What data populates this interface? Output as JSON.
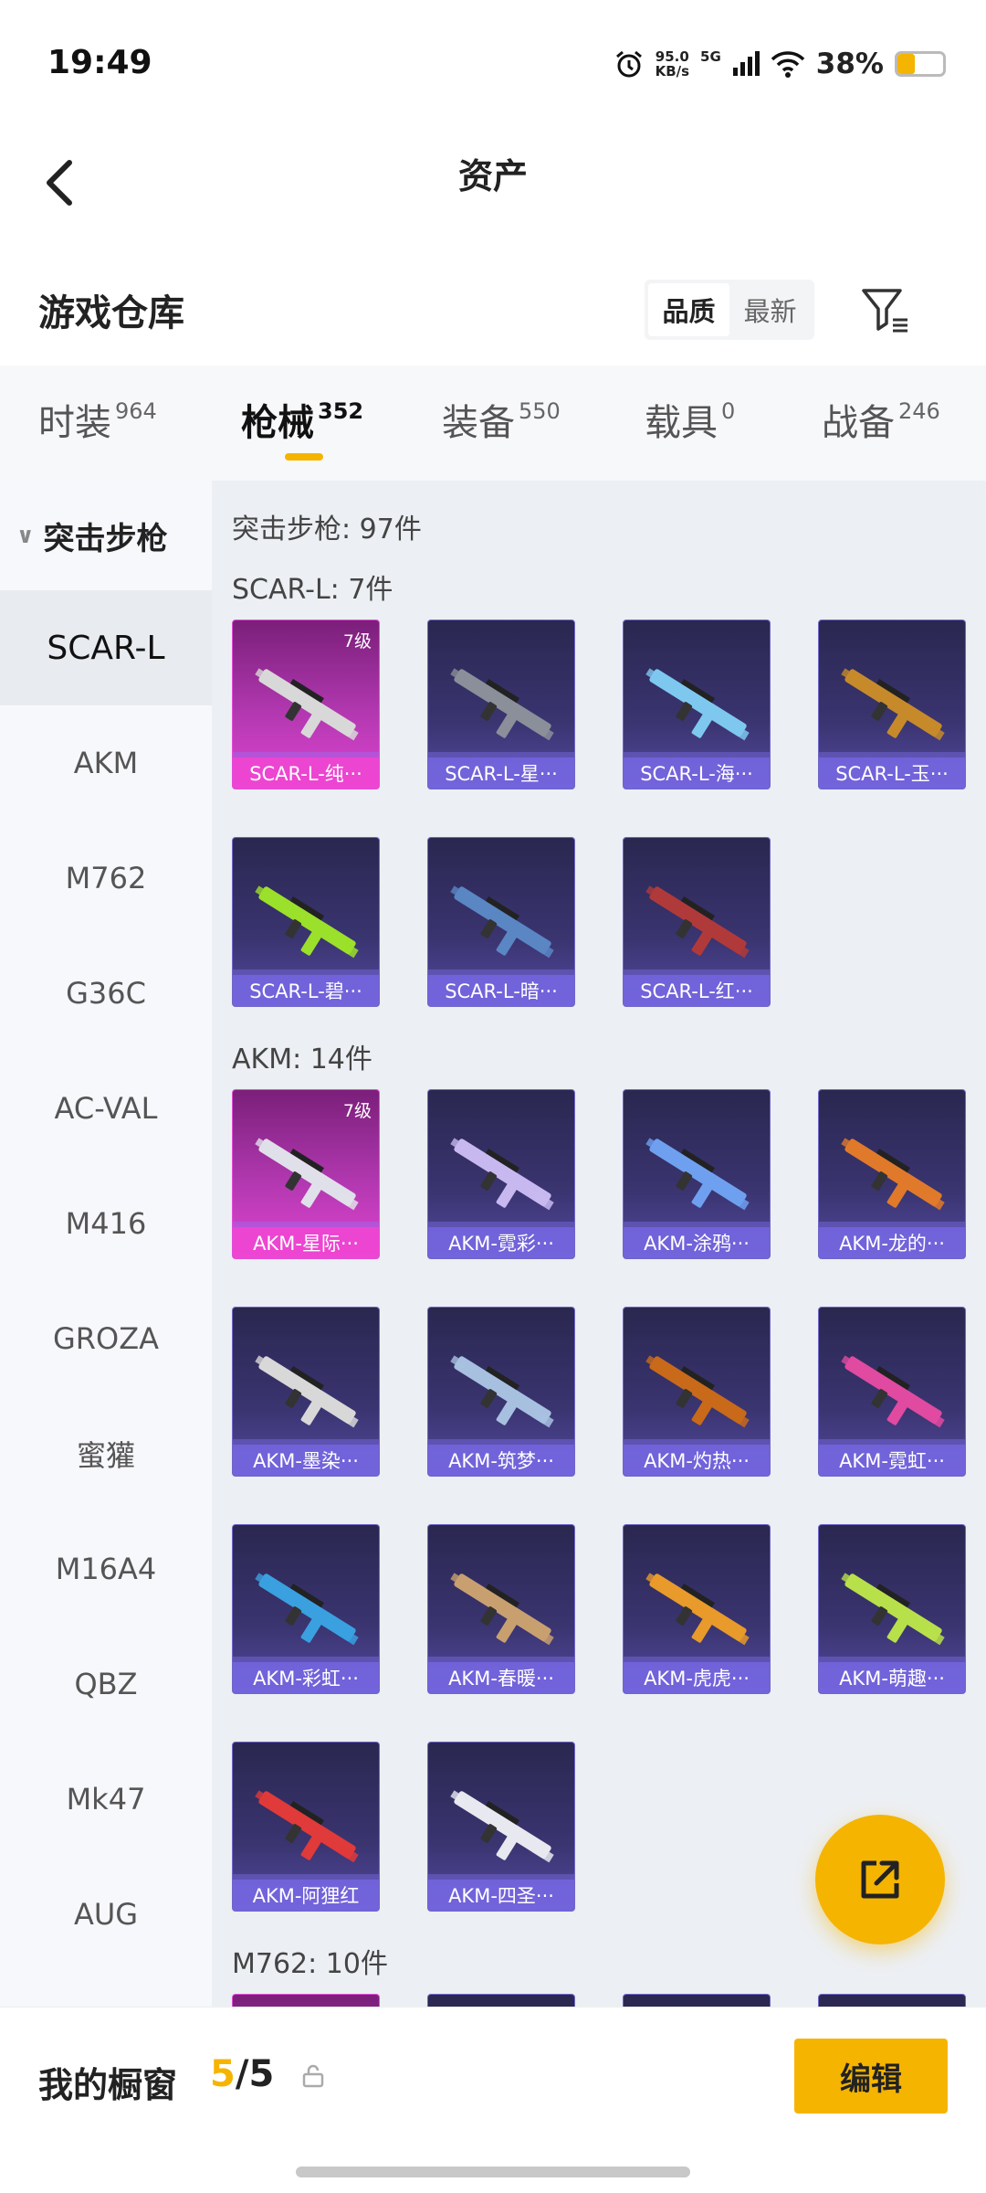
{
  "status": {
    "time": "19:49",
    "speed_top": "95.0",
    "speed_bottom": "KB/s",
    "network": "5G",
    "battery_text": "38%",
    "battery_level": 0.38
  },
  "header": {
    "title": "资产"
  },
  "warehouse": {
    "title": "游戏仓库",
    "sort_options": [
      {
        "label": "品质",
        "active": true
      },
      {
        "label": "最新",
        "active": false
      }
    ]
  },
  "tabs": [
    {
      "label": "时装",
      "count": "964",
      "active": false
    },
    {
      "label": "枪械",
      "count": "352",
      "active": true
    },
    {
      "label": "装备",
      "count": "550",
      "active": false
    },
    {
      "label": "载具",
      "count": "0",
      "active": false
    },
    {
      "label": "战备",
      "count": "246",
      "active": false
    }
  ],
  "sidebar": {
    "category": "突击步枪",
    "items": [
      "SCAR-L",
      "AKM",
      "M762",
      "G36C",
      "AC-VAL",
      "M416",
      "GROZA",
      "蜜獾",
      "M16A4",
      "QBZ",
      "Mk47",
      "AUG"
    ],
    "active_index": 0
  },
  "content": {
    "total": "突击步枪: 97件",
    "sections": [
      {
        "title": "SCAR-L: 7件",
        "items": [
          {
            "name": "SCAR-L-纯···",
            "level": "7级",
            "rare": true,
            "color": "#d8d8d8"
          },
          {
            "name": "SCAR-L-星···",
            "level": "",
            "rare": false,
            "color": "#8a8f99"
          },
          {
            "name": "SCAR-L-海···",
            "level": "",
            "rare": false,
            "color": "#7ec8f0"
          },
          {
            "name": "SCAR-L-玉···",
            "level": "",
            "rare": false,
            "color": "#c78a2a"
          },
          {
            "name": "SCAR-L-碧···",
            "level": "",
            "rare": false,
            "color": "#9be02a"
          },
          {
            "name": "SCAR-L-暗···",
            "level": "",
            "rare": false,
            "color": "#5a86c4"
          },
          {
            "name": "SCAR-L-红···",
            "level": "",
            "rare": false,
            "color": "#b03a3a"
          }
        ]
      },
      {
        "title": "AKM: 14件",
        "items": [
          {
            "name": "AKM-星际···",
            "level": "7级",
            "rare": true,
            "color": "#e0e0ea"
          },
          {
            "name": "AKM-霓彩···",
            "level": "",
            "rare": false,
            "color": "#c8b8f0"
          },
          {
            "name": "AKM-涂鸦···",
            "level": "",
            "rare": false,
            "color": "#6fa0f0"
          },
          {
            "name": "AKM-龙的···",
            "level": "",
            "rare": false,
            "color": "#e07a2a"
          },
          {
            "name": "AKM-墨染···",
            "level": "",
            "rare": false,
            "color": "#d8d8d8"
          },
          {
            "name": "AKM-筑梦···",
            "level": "",
            "rare": false,
            "color": "#a8c0e0"
          },
          {
            "name": "AKM-灼热···",
            "level": "",
            "rare": false,
            "color": "#c86a1a"
          },
          {
            "name": "AKM-霓虹···",
            "level": "",
            "rare": false,
            "color": "#e04aa0"
          },
          {
            "name": "AKM-彩虹···",
            "level": "",
            "rare": false,
            "color": "#3aa0e0"
          },
          {
            "name": "AKM-春暖···",
            "level": "",
            "rare": false,
            "color": "#c8a070"
          },
          {
            "name": "AKM-虎虎···",
            "level": "",
            "rare": false,
            "color": "#e89a2a"
          },
          {
            "name": "AKM-萌趣···",
            "level": "",
            "rare": false,
            "color": "#b8e04a"
          },
          {
            "name": "AKM-阿狸红",
            "level": "",
            "rare": false,
            "color": "#e03a3a"
          },
          {
            "name": "AKM-四圣···",
            "level": "",
            "rare": false,
            "color": "#e8e8f0"
          }
        ]
      },
      {
        "title": "M762: 10件",
        "items": []
      }
    ]
  },
  "bottom": {
    "label": "我的橱窗",
    "count_current": "5",
    "count_sep": "/",
    "count_total": "5",
    "edit_label": "编辑"
  }
}
